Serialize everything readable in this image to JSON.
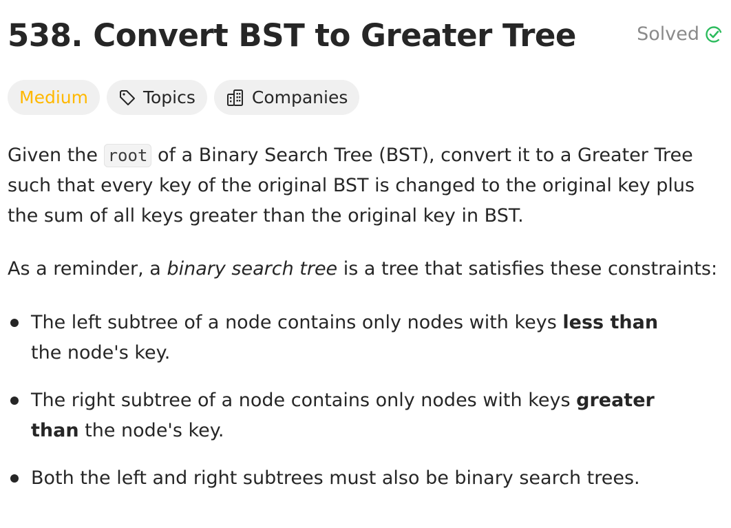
{
  "problem": {
    "title": "538. Convert BST to Greater Tree",
    "status": "Solved",
    "status_color": "#2cbb5d"
  },
  "tags": {
    "difficulty": "Medium",
    "difficulty_color": "#ffb800",
    "topics": "Topics",
    "companies": "Companies"
  },
  "description": {
    "intro_1": "Given the ",
    "intro_code": "root",
    "intro_2": " of a Binary Search Tree (BST), convert it to a Greater Tree such that every key of the original BST is changed to the original key plus the sum of all keys greater than the original key in BST.",
    "reminder_1": "As a reminder, a ",
    "reminder_em": "binary search tree",
    "reminder_2": " is a tree that satisfies these constraints:",
    "constraints": [
      {
        "before": "The left subtree of a node contains only nodes with keys ",
        "bold": "less than",
        "after": " the node's key."
      },
      {
        "before": "The right subtree of a node contains only nodes with keys ",
        "bold": "greater than",
        "after": " the node's key."
      },
      {
        "text": "Both the left and right subtrees must also be binary search trees."
      }
    ]
  },
  "icons": {
    "status": "check-circle-icon",
    "topics": "tag-icon",
    "companies": "building-icon"
  }
}
